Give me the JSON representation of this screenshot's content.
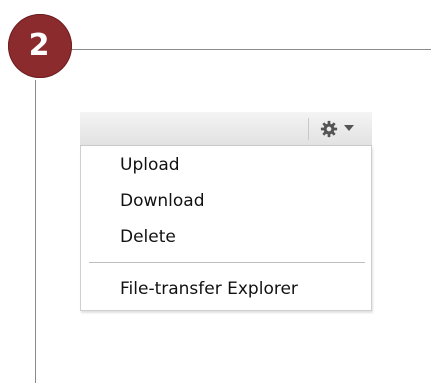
{
  "step": {
    "number": "2",
    "badge_color": "#8c2b2d"
  },
  "toolbar": {
    "gear_icon": "gear-icon",
    "dropdown_icon": "chevron-down-icon"
  },
  "menu": {
    "items": [
      {
        "label": "Upload"
      },
      {
        "label": "Download"
      },
      {
        "label": "Delete"
      }
    ],
    "secondary_items": [
      {
        "label": "File-transfer Explorer"
      }
    ]
  }
}
